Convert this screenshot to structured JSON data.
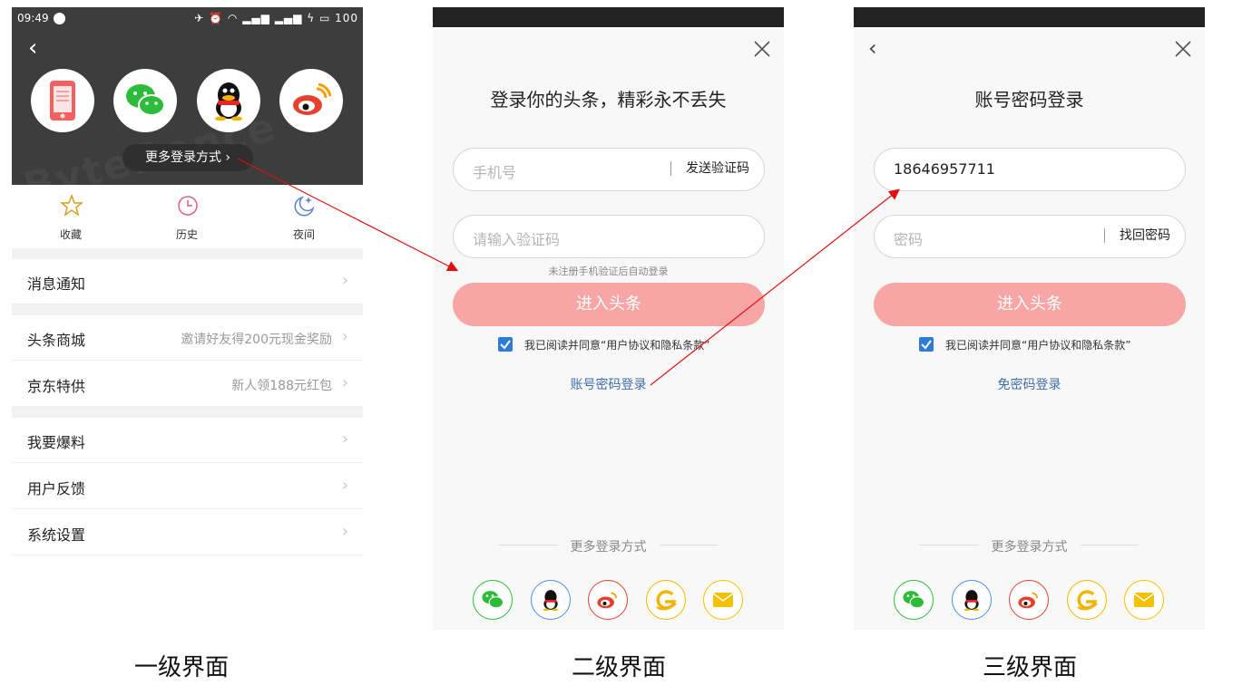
{
  "screen1": {
    "status": {
      "time": "09:49",
      "battery": "100"
    },
    "social_icons": [
      "phone-icon",
      "wechat-icon",
      "qq-icon",
      "weibo-icon"
    ],
    "more_login": "更多登录方式",
    "quick_actions": [
      {
        "label": "收藏",
        "icon": "star-icon"
      },
      {
        "label": "历史",
        "icon": "history-icon"
      },
      {
        "label": "夜间",
        "icon": "night-icon"
      }
    ],
    "menu": [
      {
        "label": "消息通知",
        "hint": ""
      },
      {
        "label": "头条商城",
        "hint": "邀请好友得200元现金奖励"
      },
      {
        "label": "京东特供",
        "hint": "新人领188元红包"
      },
      {
        "label": "我要爆料",
        "hint": ""
      },
      {
        "label": "用户反馈",
        "hint": ""
      },
      {
        "label": "系统设置",
        "hint": ""
      }
    ]
  },
  "screen2": {
    "title": "登录你的头条，精彩永不丢失",
    "phone_placeholder": "手机号",
    "send_code": "发送验证码",
    "code_placeholder": "请输入验证码",
    "note": "未注册手机验证后自动登录",
    "enter": "进入头条",
    "agree": "我已阅读并同意“用户协议和隐私条款”",
    "alt_login": "账号密码登录",
    "more_login": "更多登录方式"
  },
  "screen3": {
    "title": "账号密码登录",
    "account_value": "18646957711",
    "password_placeholder": "密码",
    "retrieve": "找回密码",
    "enter": "进入头条",
    "agree": "我已阅读并同意“用户协议和隐私条款”",
    "alt_login": "免密码登录",
    "more_login": "更多登录方式"
  },
  "bottom_icons": [
    {
      "name": "wechat-icon",
      "color": "#2dbb3a"
    },
    {
      "name": "qq-icon",
      "color": "#4a90e2"
    },
    {
      "name": "weibo-icon",
      "color": "#e6402e"
    },
    {
      "name": "tianyi-icon",
      "color": "#f5b400"
    },
    {
      "name": "mail-icon",
      "color": "#f5c000"
    }
  ],
  "captions": [
    "一级界面",
    "二级界面",
    "三级界面"
  ],
  "colors": {
    "accent_pink": "#f7a6a5",
    "link_blue": "#3e6ea8",
    "arrow_red": "#e01010"
  }
}
